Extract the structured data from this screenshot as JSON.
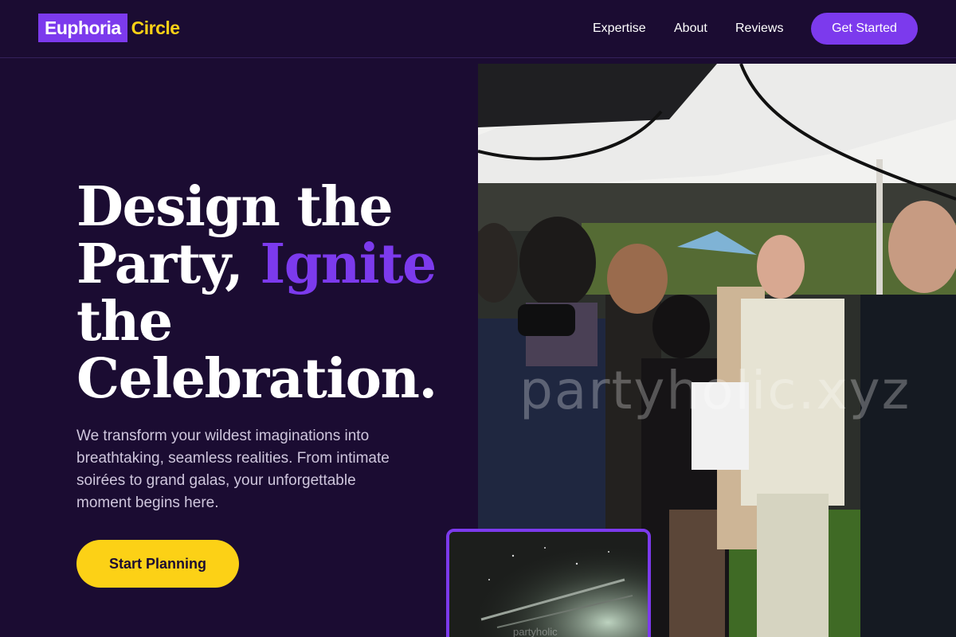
{
  "brand": {
    "name_part1": "Euphoria",
    "name_part2": "Circle",
    "colors": {
      "primary": "#7c3aed",
      "accent": "#fcd116",
      "background": "#1b0c32"
    }
  },
  "nav": {
    "links": [
      "Expertise",
      "About",
      "Reviews"
    ],
    "cta": "Get Started"
  },
  "hero": {
    "headline_line1": "Design the",
    "headline_line2_a": "Party, ",
    "headline_line2_b": "Ignite",
    "headline_line3": "the",
    "headline_line4": "Celebration.",
    "subtext": "We transform your wildest imaginations into breathtaking, seamless realities. From intimate soirées to grand galas, your unforgettable moment begins here.",
    "primary_button": "Start Planning",
    "image_watermark": "partyholic.xyz",
    "thumb_watermark": "partyholic"
  }
}
